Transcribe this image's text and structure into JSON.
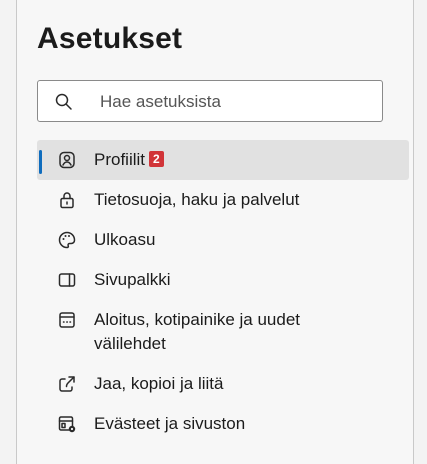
{
  "settings": {
    "title": "Asetukset",
    "search": {
      "placeholder": "Hae asetuksista"
    },
    "items": [
      {
        "label": "Profiilit",
        "badge": "2",
        "icon": "profile-icon",
        "active": true
      },
      {
        "label": "Tietosuoja, haku ja palvelut",
        "icon": "lock-icon"
      },
      {
        "label": "Ulkoasu",
        "icon": "palette-icon"
      },
      {
        "label": "Sivupalkki",
        "icon": "sidebar-icon"
      },
      {
        "label": "Aloitus, kotipainike ja uudet välilehdet",
        "icon": "home-tab-icon"
      },
      {
        "label": "Jaa, kopioi ja liitä",
        "icon": "share-icon"
      },
      {
        "label": "Evästeet ja sivuston",
        "icon": "cookies-site-icon"
      }
    ],
    "accent_color": "#0f6cbd",
    "badge_color": "#d13438"
  }
}
